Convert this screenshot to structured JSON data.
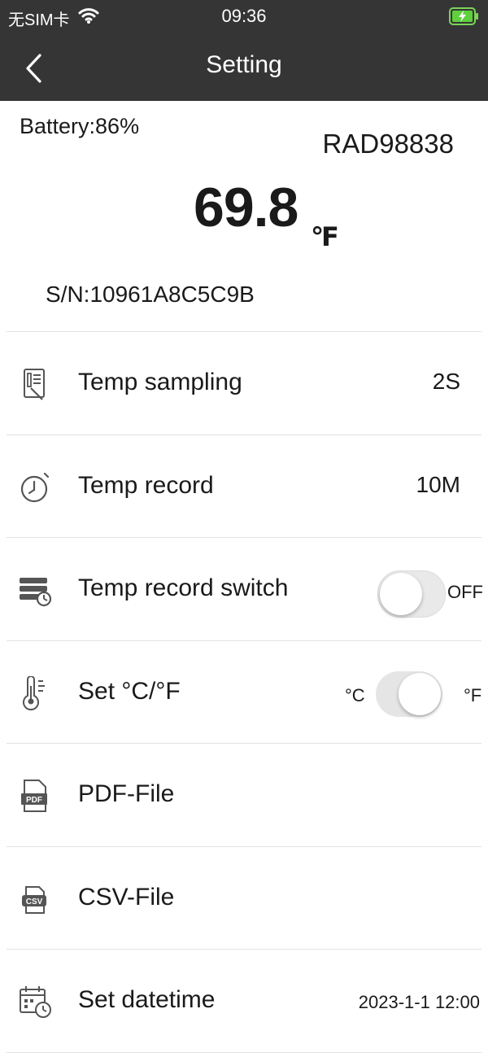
{
  "status_bar": {
    "carrier": "无SIM卡",
    "time": "09:36",
    "icons": [
      "wifi-icon",
      "battery-charging-icon"
    ]
  },
  "nav": {
    "title": "Setting",
    "back_icon": "chevron-left-icon"
  },
  "device": {
    "battery": "Battery:86%",
    "name": "RAD98838",
    "temperature": "69.8",
    "unit": "℉",
    "serial": "S/N:10961A8C5C9B"
  },
  "settings": {
    "temp_sampling": {
      "label": "Temp sampling",
      "value": "2S",
      "icon": "sampling-clipboard-icon"
    },
    "temp_record": {
      "label": "Temp record",
      "value": "10M",
      "icon": "stopwatch-icon"
    },
    "record_switch": {
      "label": "Temp record switch",
      "state": "OFF",
      "icon": "storage-clock-icon"
    },
    "unit_switch": {
      "label": "Set °C/°F",
      "left_option": "°C",
      "right_option": "°F",
      "icon": "thermometer-icon"
    },
    "pdf_file": {
      "label": "PDF-File",
      "icon": "pdf-file-icon"
    },
    "csv_file": {
      "label": "CSV-File",
      "icon": "csv-file-icon"
    },
    "datetime": {
      "label": "Set datetime",
      "value": "2023-1-1 12:00",
      "icon": "calendar-clock-icon"
    }
  }
}
